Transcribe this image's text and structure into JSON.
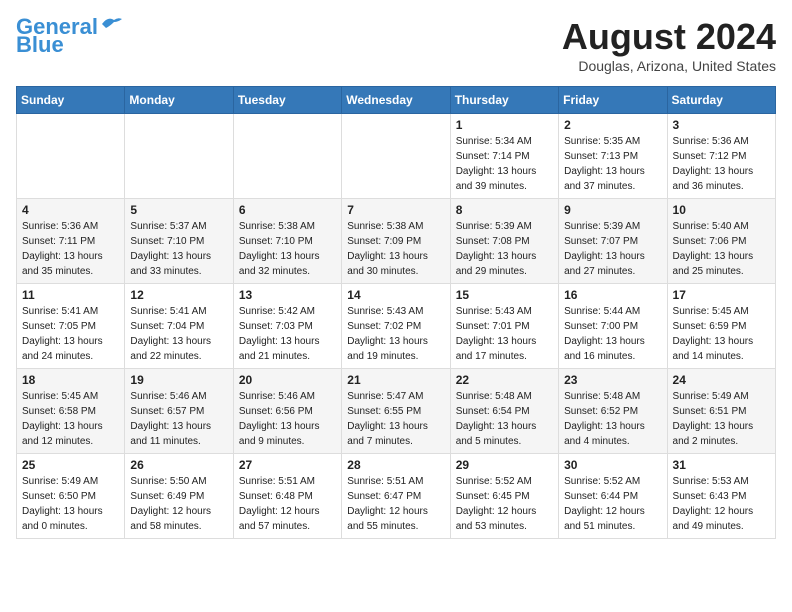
{
  "header": {
    "logo_line1": "General",
    "logo_line2": "Blue",
    "month_title": "August 2024",
    "subtitle": "Douglas, Arizona, United States"
  },
  "days_of_week": [
    "Sunday",
    "Monday",
    "Tuesday",
    "Wednesday",
    "Thursday",
    "Friday",
    "Saturday"
  ],
  "weeks": [
    [
      {
        "num": "",
        "info": ""
      },
      {
        "num": "",
        "info": ""
      },
      {
        "num": "",
        "info": ""
      },
      {
        "num": "",
        "info": ""
      },
      {
        "num": "1",
        "info": "Sunrise: 5:34 AM\nSunset: 7:14 PM\nDaylight: 13 hours\nand 39 minutes."
      },
      {
        "num": "2",
        "info": "Sunrise: 5:35 AM\nSunset: 7:13 PM\nDaylight: 13 hours\nand 37 minutes."
      },
      {
        "num": "3",
        "info": "Sunrise: 5:36 AM\nSunset: 7:12 PM\nDaylight: 13 hours\nand 36 minutes."
      }
    ],
    [
      {
        "num": "4",
        "info": "Sunrise: 5:36 AM\nSunset: 7:11 PM\nDaylight: 13 hours\nand 35 minutes."
      },
      {
        "num": "5",
        "info": "Sunrise: 5:37 AM\nSunset: 7:10 PM\nDaylight: 13 hours\nand 33 minutes."
      },
      {
        "num": "6",
        "info": "Sunrise: 5:38 AM\nSunset: 7:10 PM\nDaylight: 13 hours\nand 32 minutes."
      },
      {
        "num": "7",
        "info": "Sunrise: 5:38 AM\nSunset: 7:09 PM\nDaylight: 13 hours\nand 30 minutes."
      },
      {
        "num": "8",
        "info": "Sunrise: 5:39 AM\nSunset: 7:08 PM\nDaylight: 13 hours\nand 29 minutes."
      },
      {
        "num": "9",
        "info": "Sunrise: 5:39 AM\nSunset: 7:07 PM\nDaylight: 13 hours\nand 27 minutes."
      },
      {
        "num": "10",
        "info": "Sunrise: 5:40 AM\nSunset: 7:06 PM\nDaylight: 13 hours\nand 25 minutes."
      }
    ],
    [
      {
        "num": "11",
        "info": "Sunrise: 5:41 AM\nSunset: 7:05 PM\nDaylight: 13 hours\nand 24 minutes."
      },
      {
        "num": "12",
        "info": "Sunrise: 5:41 AM\nSunset: 7:04 PM\nDaylight: 13 hours\nand 22 minutes."
      },
      {
        "num": "13",
        "info": "Sunrise: 5:42 AM\nSunset: 7:03 PM\nDaylight: 13 hours\nand 21 minutes."
      },
      {
        "num": "14",
        "info": "Sunrise: 5:43 AM\nSunset: 7:02 PM\nDaylight: 13 hours\nand 19 minutes."
      },
      {
        "num": "15",
        "info": "Sunrise: 5:43 AM\nSunset: 7:01 PM\nDaylight: 13 hours\nand 17 minutes."
      },
      {
        "num": "16",
        "info": "Sunrise: 5:44 AM\nSunset: 7:00 PM\nDaylight: 13 hours\nand 16 minutes."
      },
      {
        "num": "17",
        "info": "Sunrise: 5:45 AM\nSunset: 6:59 PM\nDaylight: 13 hours\nand 14 minutes."
      }
    ],
    [
      {
        "num": "18",
        "info": "Sunrise: 5:45 AM\nSunset: 6:58 PM\nDaylight: 13 hours\nand 12 minutes."
      },
      {
        "num": "19",
        "info": "Sunrise: 5:46 AM\nSunset: 6:57 PM\nDaylight: 13 hours\nand 11 minutes."
      },
      {
        "num": "20",
        "info": "Sunrise: 5:46 AM\nSunset: 6:56 PM\nDaylight: 13 hours\nand 9 minutes."
      },
      {
        "num": "21",
        "info": "Sunrise: 5:47 AM\nSunset: 6:55 PM\nDaylight: 13 hours\nand 7 minutes."
      },
      {
        "num": "22",
        "info": "Sunrise: 5:48 AM\nSunset: 6:54 PM\nDaylight: 13 hours\nand 5 minutes."
      },
      {
        "num": "23",
        "info": "Sunrise: 5:48 AM\nSunset: 6:52 PM\nDaylight: 13 hours\nand 4 minutes."
      },
      {
        "num": "24",
        "info": "Sunrise: 5:49 AM\nSunset: 6:51 PM\nDaylight: 13 hours\nand 2 minutes."
      }
    ],
    [
      {
        "num": "25",
        "info": "Sunrise: 5:49 AM\nSunset: 6:50 PM\nDaylight: 13 hours\nand 0 minutes."
      },
      {
        "num": "26",
        "info": "Sunrise: 5:50 AM\nSunset: 6:49 PM\nDaylight: 12 hours\nand 58 minutes."
      },
      {
        "num": "27",
        "info": "Sunrise: 5:51 AM\nSunset: 6:48 PM\nDaylight: 12 hours\nand 57 minutes."
      },
      {
        "num": "28",
        "info": "Sunrise: 5:51 AM\nSunset: 6:47 PM\nDaylight: 12 hours\nand 55 minutes."
      },
      {
        "num": "29",
        "info": "Sunrise: 5:52 AM\nSunset: 6:45 PM\nDaylight: 12 hours\nand 53 minutes."
      },
      {
        "num": "30",
        "info": "Sunrise: 5:52 AM\nSunset: 6:44 PM\nDaylight: 12 hours\nand 51 minutes."
      },
      {
        "num": "31",
        "info": "Sunrise: 5:53 AM\nSunset: 6:43 PM\nDaylight: 12 hours\nand 49 minutes."
      }
    ]
  ]
}
